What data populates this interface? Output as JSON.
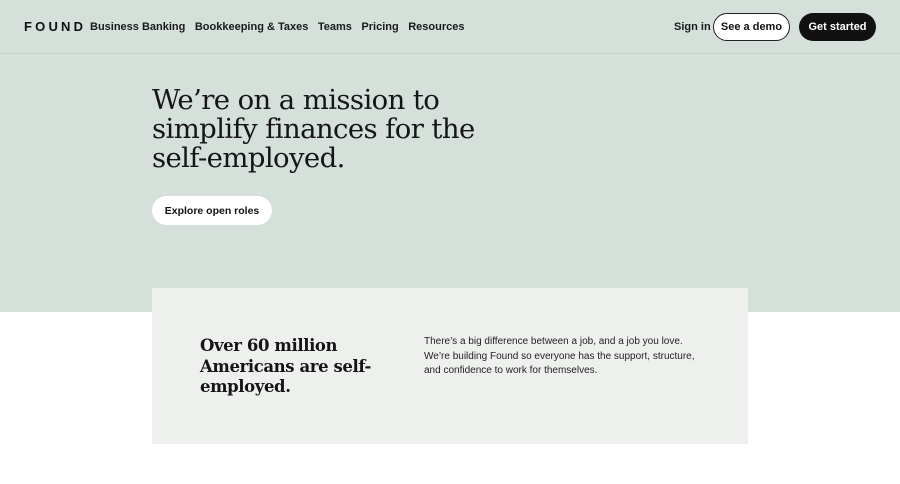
{
  "brand": {
    "logo": "FOUND"
  },
  "nav": {
    "links": [
      "Business Banking",
      "Bookkeeping & Taxes",
      "Teams",
      "Pricing",
      "Resources"
    ],
    "sign_in": "Sign in",
    "demo_label": "See a demo",
    "start_label": "Get started"
  },
  "hero": {
    "headline": "We’re on a mission to simplify finances for the self-employed.",
    "cta_label": "Explore open roles"
  },
  "stat_card": {
    "title": "Over 60 million Americans are self-employed.",
    "body": "There’s a big difference between a job, and a job you love. We’re building Found so everyone has the support, structure, and confidence to work for themselves."
  },
  "colors": {
    "hero_bg": "#d5e0da",
    "card_bg": "#eef0ee",
    "primary_button": "#111111"
  }
}
